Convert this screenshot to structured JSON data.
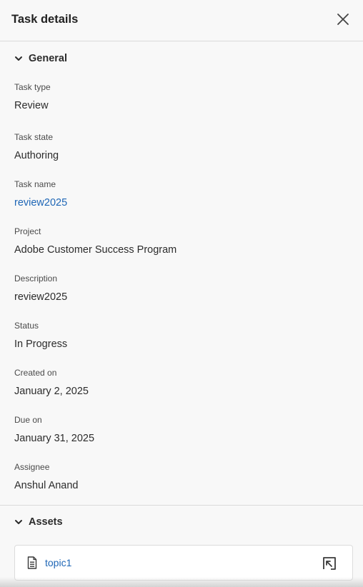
{
  "header": {
    "title": "Task details"
  },
  "general": {
    "title": "General",
    "fields": [
      {
        "label": "Task type",
        "value": "Review"
      },
      {
        "label": "Task state",
        "value": "Authoring"
      },
      {
        "label": "Task name",
        "value": "review2025"
      },
      {
        "label": "Project",
        "value": "Adobe Customer Success Program"
      },
      {
        "label": "Description",
        "value": "review2025"
      },
      {
        "label": "Status",
        "value": "In Progress"
      },
      {
        "label": "Created on",
        "value": "January 2, 2025"
      },
      {
        "label": "Due on",
        "value": "January 31, 2025"
      },
      {
        "label": "Assignee",
        "value": "Anshul Anand"
      }
    ]
  },
  "assets": {
    "title": "Assets",
    "items": [
      {
        "name": "topic1"
      }
    ]
  },
  "colors": {
    "link": "#1e66b6",
    "background": "#f8f8f8",
    "divider": "#dadada"
  },
  "icons": {
    "close": "close-icon",
    "chevron": "chevron-down-icon",
    "document": "document-icon",
    "open": "open-in-icon"
  }
}
